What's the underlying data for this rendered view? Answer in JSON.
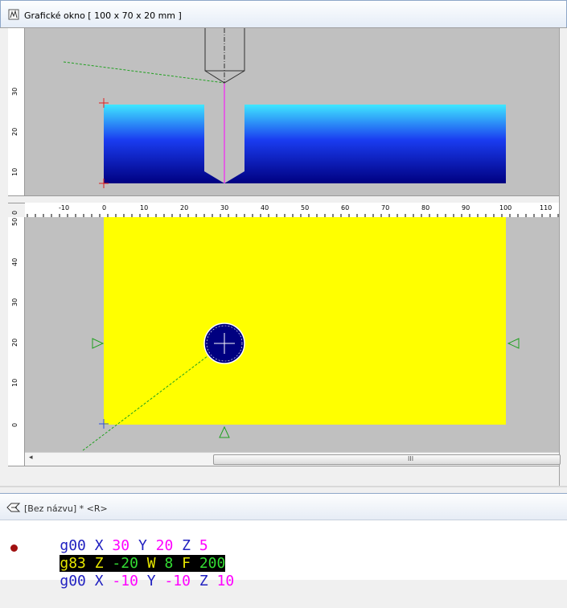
{
  "window": {
    "title": "Grafické okno [ 100 x 70 x 20 mm ]"
  },
  "side_view": {
    "y_ticks": [
      "30",
      "20",
      "10",
      "0"
    ]
  },
  "top_view": {
    "x_ticks": [
      "-10",
      "0",
      "10",
      "20",
      "30",
      "40",
      "50",
      "60",
      "70",
      "80",
      "90",
      "100",
      "110"
    ],
    "y_ticks": [
      "50",
      "40",
      "30",
      "20",
      "10",
      "0"
    ],
    "scroll_grip": "III"
  },
  "colors": {
    "stock_face": "#ffff00",
    "tool_circle": "#000080",
    "background": "#c0c0c0"
  },
  "editor": {
    "title": "[Bez názvu] * <R>",
    "lines": [
      {
        "kw": "g00",
        "tokens": [
          [
            "X",
            "30"
          ],
          [
            "Y",
            "20"
          ],
          [
            "Z",
            "5"
          ]
        ]
      },
      {
        "kw": "g83",
        "tokens": [
          [
            "Z",
            "-20"
          ],
          [
            "W",
            "8"
          ],
          [
            "F",
            "200"
          ]
        ],
        "highlighted": true
      },
      {
        "kw": "g00",
        "tokens": [
          [
            "X",
            "-10"
          ],
          [
            "Y",
            "-10"
          ],
          [
            "Z",
            "10"
          ]
        ]
      }
    ],
    "line1": {
      "g": "g00",
      "a": "X",
      "av": "30",
      "b": "Y",
      "bv": "20",
      "c": "Z",
      "cv": "5"
    },
    "line2": {
      "g": "g83",
      "a": "Z",
      "av": "-20",
      "b": "W",
      "bv": "8",
      "c": "F",
      "cv": "200"
    },
    "line3": {
      "g": "g00",
      "a": "X",
      "av": "-10",
      "b": "Y",
      "bv": "-10",
      "c": "Z",
      "cv": "10"
    }
  }
}
